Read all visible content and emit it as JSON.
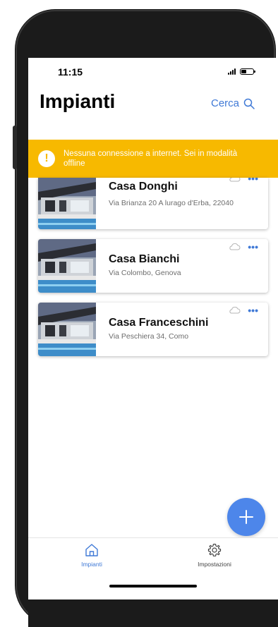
{
  "status_bar": {
    "time": "11:15"
  },
  "header": {
    "title": "Impianti",
    "search_label": "Cerca"
  },
  "banner": {
    "icon": "exclamation-icon",
    "message": "Nessuna connessione a internet. Sei in modalità offline"
  },
  "plants": [
    {
      "name": "Casa Donghi",
      "address": "Via Brianza 20 A lurago d'Erba, 22040"
    },
    {
      "name": "Casa Bianchi",
      "address": "Via Colombo, Genova"
    },
    {
      "name": "Casa Franceschini",
      "address": "Via Peschiera 34, Como"
    }
  ],
  "tabs": [
    {
      "label": "Impianti",
      "icon": "home-icon",
      "active": true
    },
    {
      "label": "Impostazioni",
      "icon": "gear-icon",
      "active": false
    }
  ],
  "colors": {
    "accent": "#3f79d6",
    "banner": "#f7b900",
    "fab": "#4d86ea"
  }
}
